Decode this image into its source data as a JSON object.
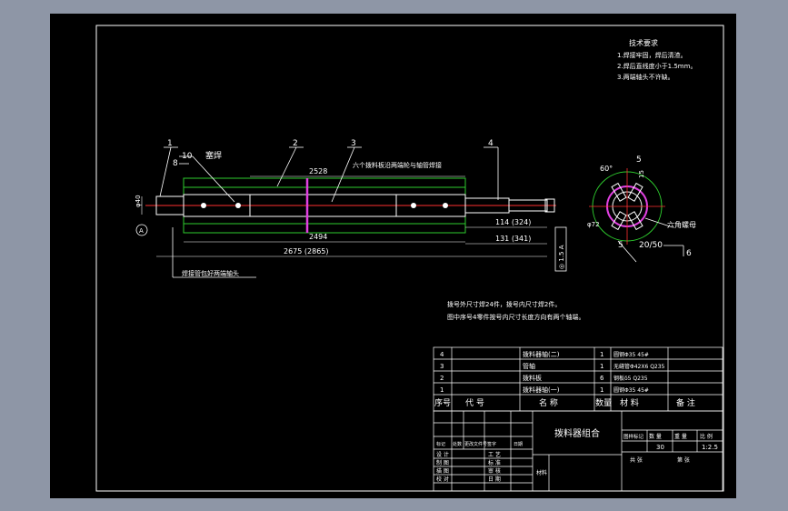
{
  "tech_requirements": {
    "title": "技术要求",
    "items": [
      "1.焊接牢固，焊后清渣。",
      "2.焊后直线度小于1.5mm。",
      "3.两端轴头不许缺。"
    ]
  },
  "balloons": [
    "1",
    "2",
    "3",
    "4",
    "5",
    "6",
    "8",
    "10"
  ],
  "weld_label": "塞焊",
  "callout_six_plates": "六个拨料板沿两端轮与轴管焊接",
  "callout_full_weld": "焊接管包好两端轴头",
  "datum_label": "A",
  "dims": {
    "len_2528": "2528",
    "len_2494": "2494",
    "len_total": "2675 (2865)",
    "len_114": "114 (324)",
    "len_131": "131 (341)",
    "dia_left": "φ40",
    "tol_frame": "◎ 1.5 A"
  },
  "section": {
    "angle": "60°",
    "dim_15": "15",
    "dia": "φ72",
    "bolt_label": "六角螺母",
    "weld_note": "20/50",
    "mark_5": "5",
    "mark_6": "6"
  },
  "notes": [
    "拨号外尺寸焊24件，拨号内尺寸焊2件。",
    "图中序号4零件按号内尺寸长度方向有两个轴端。"
  ],
  "bom": {
    "rows": [
      {
        "no": "4",
        "name": "拨料器轴(二)",
        "qty": "1",
        "material": "圆钢Φ35 45#",
        "note": ""
      },
      {
        "no": "3",
        "name": "管轴",
        "qty": "1",
        "material": "无缝管Φ42X6 Q235",
        "note": ""
      },
      {
        "no": "2",
        "name": "拨料板",
        "qty": "6",
        "material": "钢板δ5 Q235",
        "note": ""
      },
      {
        "no": "1",
        "name": "拨料器轴(一)",
        "qty": "1",
        "material": "圆钢Φ35 45#",
        "note": ""
      }
    ],
    "headers": [
      "序号",
      "代 号",
      "名 称",
      "数量",
      "材 料",
      "备 注"
    ]
  },
  "title_block": {
    "drawing_name": "拨料器组合",
    "stage_label": "图样标记",
    "weight_label": "重 量",
    "qty_label": "数 量",
    "scale_label": "比 例",
    "weight_value": "30",
    "scale_value": "1:2.5",
    "sheet_total": "共    张",
    "sheet_no": "第    张",
    "left_labels": [
      "设 计",
      "制 图",
      "描 图",
      "校 对"
    ],
    "mid_labels": [
      "工 艺",
      "标 准",
      "审 核",
      "日 期"
    ],
    "revision_labels": [
      "标记",
      "处数",
      "更改文件号",
      "签字",
      "日期"
    ],
    "material_label": "材料"
  }
}
